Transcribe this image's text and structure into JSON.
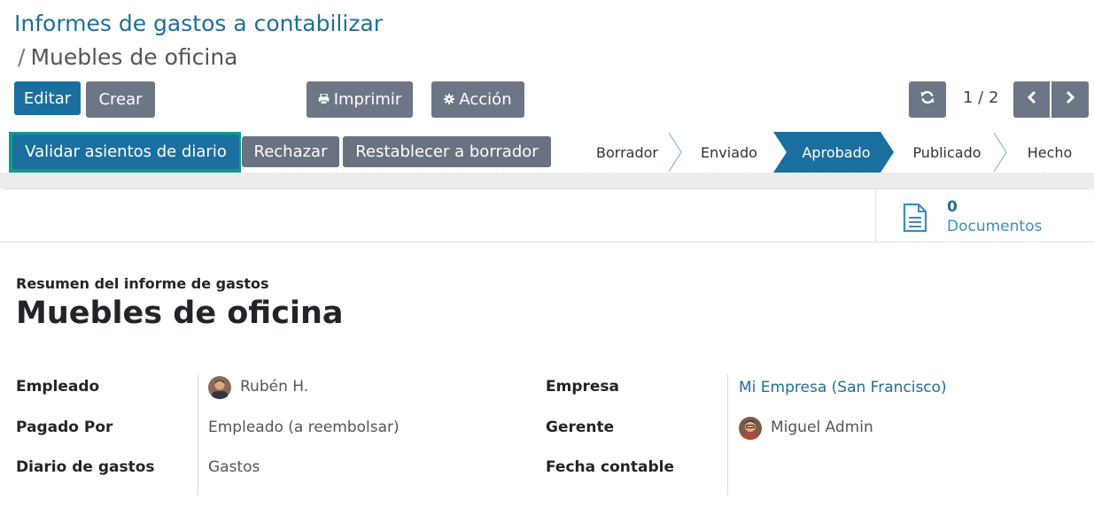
{
  "breadcrumb": {
    "parent": "Informes de gastos a contabilizar",
    "separator": "/",
    "current": "Muebles de oficina"
  },
  "control_panel": {
    "edit_label": "Editar",
    "create_label": "Crear",
    "print_label": "Imprimir",
    "print_icon": "printer-icon",
    "action_label": "Acción",
    "action_icon": "gear-icon",
    "refresh_icon": "refresh-icon",
    "pager": "1 / 2",
    "prev_icon": "chevron-left-icon",
    "next_icon": "chevron-right-icon"
  },
  "statusbar": {
    "buttons": {
      "validate": "Validar asientos de diario",
      "reject": "Rechazar",
      "reset": "Restablecer a borrador"
    },
    "stages": [
      "Borrador",
      "Enviado",
      "Aprobado",
      "Publicado",
      "Hecho"
    ],
    "active_stage": "Aprobado"
  },
  "smart_button": {
    "icon": "document-icon",
    "count": "0",
    "label": "Documentos"
  },
  "form": {
    "subtitle": "Resumen del informe de gastos",
    "title": "Muebles de oficina",
    "left": {
      "employee_label": "Empleado",
      "employee_value": "Rubén H.",
      "paid_by_label": "Pagado Por",
      "paid_by_value": "Empleado (a reembolsar)",
      "journal_label": "Diario de gastos",
      "journal_value": "Gastos"
    },
    "right": {
      "company_label": "Empresa",
      "company_value": "Mi Empresa (San Francisco)",
      "manager_label": "Gerente",
      "manager_value": "Miguel Admin",
      "accounting_date_label": "Fecha contable",
      "accounting_date_value": ""
    }
  },
  "colors": {
    "primary": "#1a6f9f",
    "secondary": "#6d7686",
    "highlight": "#0e9a8f",
    "link": "#1f6e9a"
  }
}
